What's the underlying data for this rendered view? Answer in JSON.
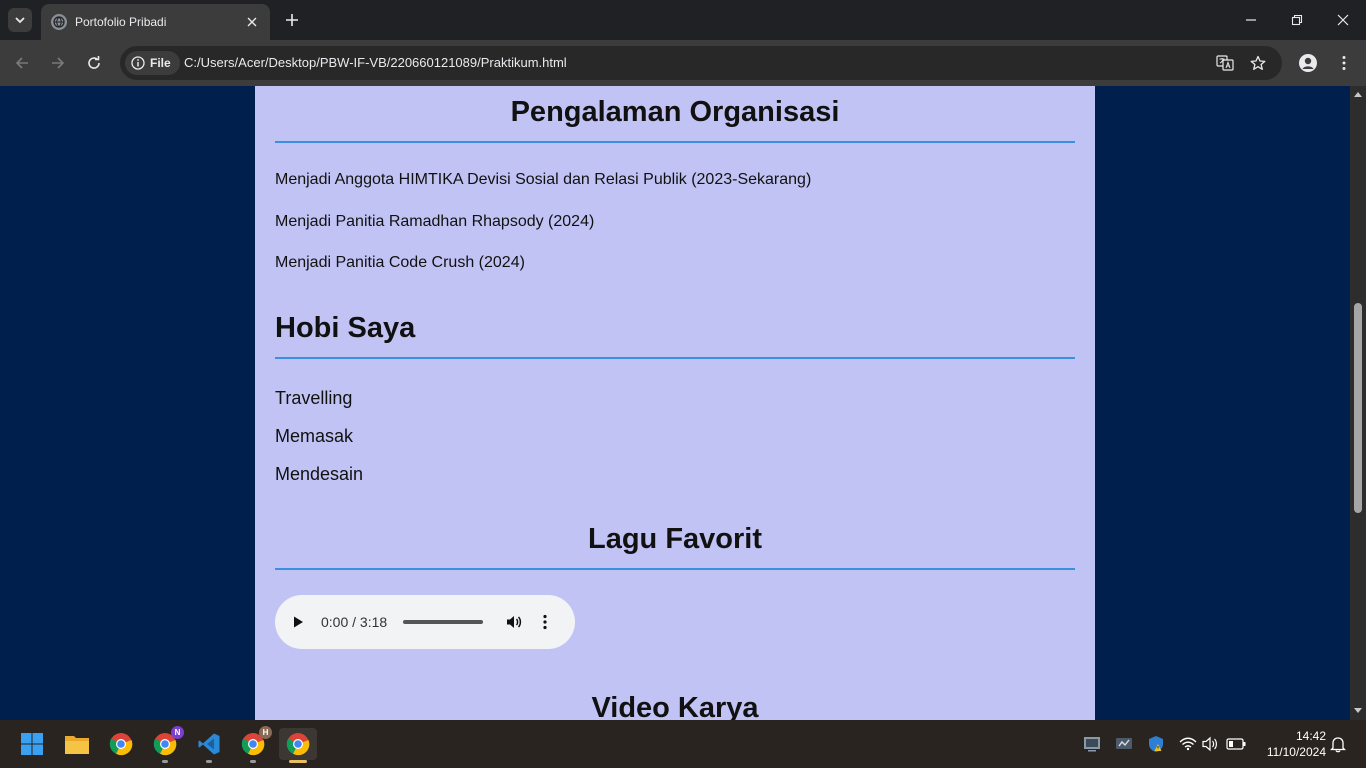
{
  "browser": {
    "tab_title": "Portofolio Pribadi",
    "site_info_label": "File",
    "url": "C:/Users/Acer/Desktop/PBW-IF-VB/220660121089/Praktikum.html"
  },
  "page": {
    "organisasi": {
      "heading": "Pengalaman Organisasi",
      "items": [
        "Menjadi Anggota HIMTIKA Devisi Sosial dan Relasi Publik (2023-Sekarang)",
        "Menjadi Panitia Ramadhan Rhapsody (2024)",
        "Menjadi Panitia Code Crush (2024)"
      ]
    },
    "hobi": {
      "heading": "Hobi Saya",
      "items": [
        "Travelling",
        "Memasak",
        "Mendesain"
      ]
    },
    "lagu": {
      "heading": "Lagu Favorit",
      "player_time": "0:00 / 3:18"
    },
    "video": {
      "heading": "Video Karya"
    }
  },
  "taskbar": {
    "badges": {
      "chrome_profile_n": "N",
      "chrome_profile_h": "H"
    },
    "time": "14:42",
    "date": "11/10/2024"
  },
  "colors": {
    "page_bg": "#001f4d",
    "container_bg": "#c2c3f5",
    "rule": "#3a8fde"
  }
}
